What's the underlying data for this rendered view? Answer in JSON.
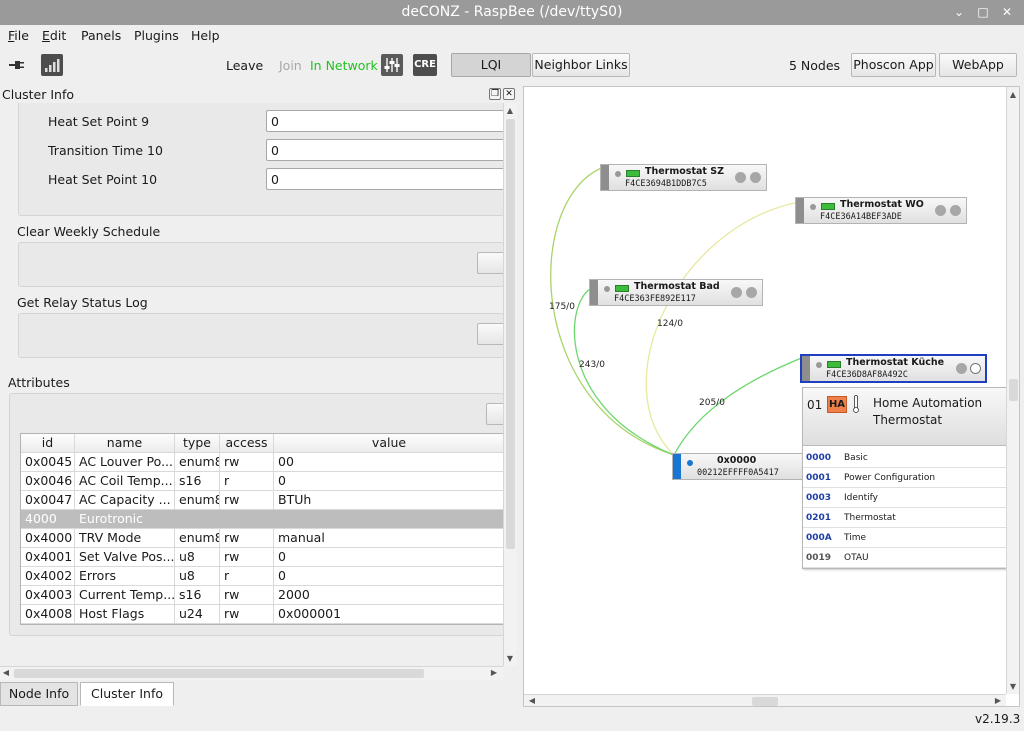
{
  "window": {
    "title": "deCONZ - RaspBee (/dev/ttyS0)",
    "minimize": "⌄",
    "maximize": "□",
    "close": "✕"
  },
  "menu": [
    {
      "label": "File",
      "mnemonic": "F",
      "rest": "ile"
    },
    {
      "label": "Edit",
      "mnemonic": "E",
      "rest": "dit"
    },
    {
      "label": "Panels",
      "mnemonic": "",
      "rest": "Panels"
    },
    {
      "label": "Plugins",
      "mnemonic": "",
      "rest": "Plugins"
    },
    {
      "label": "Help",
      "mnemonic": "",
      "rest": "Help"
    }
  ],
  "toolbar": {
    "leave": "Leave",
    "join": "Join",
    "in_network": "In Network",
    "cre": "CRE",
    "lqi": "LQI",
    "neighbor_links": "Neighbor Links",
    "node_count": "5 Nodes",
    "phoscon_app": "Phoscon App",
    "webapp": "WebApp",
    "colors": {
      "in_network": "#22c222",
      "disabled": "#a8a8a8"
    }
  },
  "cluster_info": {
    "title": "Cluster Info",
    "fields": [
      {
        "label": "Heat Set Point 9",
        "value": "0"
      },
      {
        "label": "Transition Time 10",
        "value": "0"
      },
      {
        "label": "Heat Set Point 10",
        "value": "0"
      }
    ],
    "commands": [
      {
        "label": "Clear Weekly Schedule"
      },
      {
        "label": "Get Relay Status Log"
      }
    ],
    "attributes_label": "Attributes",
    "table": {
      "headers": [
        "id",
        "name",
        "type",
        "access",
        "value"
      ],
      "rows": [
        {
          "id": "0x0045",
          "name": "AC Louver Po...",
          "type": "enum8",
          "access": "rw",
          "value": "00"
        },
        {
          "id": "0x0046",
          "name": "AC Coil Temp...",
          "type": "s16",
          "access": "r",
          "value": "0"
        },
        {
          "id": "0x0047",
          "name": "AC Capacity ...",
          "type": "enum8",
          "access": "rw",
          "value": "BTUh"
        },
        {
          "group": true,
          "id": "4000",
          "name": "Eurotronic"
        },
        {
          "id": "0x4000",
          "name": "TRV Mode",
          "type": "enum8",
          "access": "rw",
          "value": "manual"
        },
        {
          "id": "0x4001",
          "name": "Set Valve Pos...",
          "type": "u8",
          "access": "rw",
          "value": "0"
        },
        {
          "id": "0x4002",
          "name": "Errors",
          "type": "u8",
          "access": "r",
          "value": "0"
        },
        {
          "id": "0x4003",
          "name": "Current Temp...",
          "type": "s16",
          "access": "rw",
          "value": "2000"
        },
        {
          "id": "0x4008",
          "name": "Host Flags",
          "type": "u24",
          "access": "rw",
          "value": "0x000001"
        }
      ]
    }
  },
  "tabs": [
    {
      "label": "Node Info",
      "active": false
    },
    {
      "label": "Cluster Info",
      "active": true
    }
  ],
  "graph": {
    "nodes": [
      {
        "name": "Thermostat SZ",
        "mac": "F4CE3694B1DDB7C5"
      },
      {
        "name": "Thermostat WO",
        "mac": "F4CE36A14BEF3ADE"
      },
      {
        "name": "Thermostat Bad",
        "mac": "F4CE363FE892E117"
      },
      {
        "name": "Thermostat Küche",
        "mac": "F4CE36D8AF8A492C"
      },
      {
        "name": "0x0000",
        "mac": "00212EFFFF0A5417"
      }
    ],
    "links": [
      "175/0",
      "124/0",
      "243/0",
      "205/0"
    ],
    "endpoint": {
      "id": "01",
      "badge": "HA",
      "profile": "Home Automation",
      "device": "Thermostat",
      "clusters": [
        {
          "id": "0000",
          "name": "Basic",
          "server": true
        },
        {
          "id": "0001",
          "name": "Power Configuration",
          "server": true
        },
        {
          "id": "0003",
          "name": "Identify",
          "server": true
        },
        {
          "id": "0201",
          "name": "Thermostat",
          "server": true
        },
        {
          "id": "000A",
          "name": "Time",
          "server": true
        },
        {
          "id": "0019",
          "name": "OTAU",
          "server": false
        }
      ]
    }
  },
  "status": {
    "version": "v2.19.3"
  }
}
